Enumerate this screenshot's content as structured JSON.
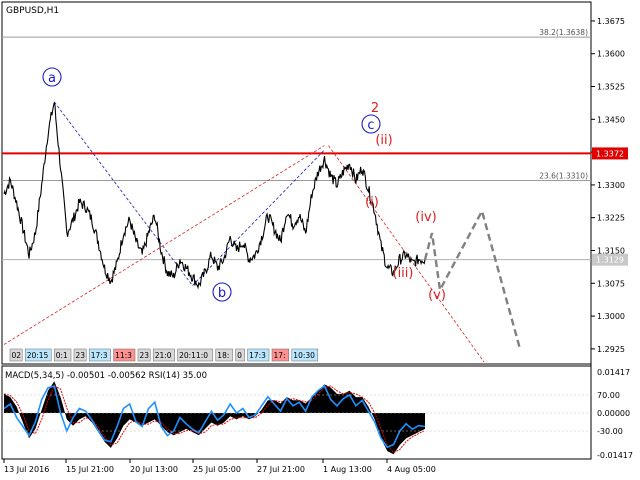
{
  "chart_title": "GBPUSD,H1",
  "indicator_title": "MACD(5,34,5) -0.00501 -0.00562 RSI(14) 35.00",
  "colors": {
    "price": "#000000",
    "resistance": "#e00000",
    "wave_blue": "#1a1acc",
    "wave_red": "#dd2020",
    "forecast": "#808080",
    "rsi": "#1e90ff",
    "current_price_bg": "#c8c8c8",
    "resistance_label_bg": "#e00000",
    "sessions_bg": "#d8d8d8"
  },
  "price_axis": {
    "ticks": [
      "1.3675",
      "1.3600",
      "1.3525",
      "1.3450",
      "1.3375",
      "1.3300",
      "1.3225",
      "1.3150",
      "1.3075",
      "1.3000",
      "1.2925"
    ],
    "resistance_label": "1.3372",
    "current_price_label": "1.3129"
  },
  "fibo_levels": [
    {
      "label": "38.2(1.3638)",
      "price": 1.3638
    },
    {
      "label": "23.6(1.3310)",
      "price": 1.331
    }
  ],
  "resistance_price": 1.3372,
  "current_price": 1.3129,
  "wave_labels": [
    {
      "text": "a",
      "style": "circle",
      "color": "blue"
    },
    {
      "text": "b",
      "style": "circle",
      "color": "blue"
    },
    {
      "text": "c",
      "style": "circle",
      "color": "blue"
    },
    {
      "text": "2",
      "style": "plain",
      "color": "red"
    },
    {
      "text": "(i)",
      "style": "plain",
      "color": "red"
    },
    {
      "text": "(ii)",
      "style": "plain",
      "color": "red"
    },
    {
      "text": "(iii)",
      "style": "plain",
      "color": "red"
    },
    {
      "text": "(iv)",
      "style": "plain",
      "color": "red"
    },
    {
      "text": "(v)",
      "style": "plain",
      "color": "red"
    }
  ],
  "sessions_strip": [
    "02",
    "20:15",
    "0:1",
    "23",
    "17:3",
    "11:3",
    "23",
    "21:0",
    "20:11:0",
    "18:",
    "0",
    "17:3",
    "17:",
    "10:30"
  ],
  "indicator_axis": {
    "ticks": [
      "0.01417",
      "70.00",
      "0.00000",
      "-30.00",
      "-0.01417"
    ]
  },
  "time_axis": [
    "13 Jul 2016",
    "15 Jul 21:00",
    "20 Jul 13:00",
    "25 Jul 05:00",
    "27 Jul 21:00",
    "1 Aug 13:00",
    "4 Aug 05:00"
  ],
  "chart_data": {
    "type": "line",
    "symbol": "GBPUSD",
    "timeframe": "H1",
    "ylim": [
      1.2895,
      1.37
    ],
    "x_labels": [
      "13 Jul 2016",
      "15 Jul 21:00",
      "20 Jul 13:00",
      "25 Jul 05:00",
      "27 Jul 21:00",
      "1 Aug 13:00",
      "4 Aug 05:00"
    ],
    "close_series": [
      1.328,
      1.331,
      1.326,
      1.32,
      1.314,
      1.319,
      1.33,
      1.342,
      1.349,
      1.334,
      1.319,
      1.322,
      1.326,
      1.325,
      1.322,
      1.317,
      1.311,
      1.308,
      1.312,
      1.319,
      1.322,
      1.317,
      1.314,
      1.319,
      1.323,
      1.315,
      1.31,
      1.309,
      1.313,
      1.311,
      1.309,
      1.307,
      1.31,
      1.314,
      1.311,
      1.313,
      1.318,
      1.315,
      1.317,
      1.313,
      1.314,
      1.318,
      1.323,
      1.32,
      1.317,
      1.324,
      1.321,
      1.323,
      1.319,
      1.328,
      1.333,
      1.336,
      1.332,
      1.33,
      1.333,
      1.335,
      1.331,
      1.334,
      1.329,
      1.324,
      1.316,
      1.311,
      1.31,
      1.313,
      1.314,
      1.312,
      1.313,
      1.3129
    ],
    "forecast_path": [
      1.3129,
      1.319,
      1.306,
      1.324,
      1.2925
    ],
    "macd_histogram": [
      0.006,
      0.005,
      0.002,
      -0.003,
      -0.008,
      -0.005,
      0.001,
      0.007,
      0.01,
      0.005,
      -0.002,
      -0.004,
      -0.002,
      -0.001,
      -0.003,
      -0.006,
      -0.009,
      -0.011,
      -0.008,
      -0.004,
      -0.002,
      -0.003,
      -0.004,
      -0.003,
      -0.002,
      -0.004,
      -0.006,
      -0.007,
      -0.006,
      -0.005,
      -0.006,
      -0.007,
      -0.005,
      -0.003,
      -0.004,
      -0.003,
      -0.001,
      -0.002,
      -0.001,
      -0.002,
      -0.001,
      0.001,
      0.004,
      0.004,
      0.003,
      0.005,
      0.004,
      0.004,
      0.003,
      0.005,
      0.007,
      0.009,
      0.008,
      0.006,
      0.006,
      0.007,
      0.005,
      0.005,
      0.002,
      -0.002,
      -0.008,
      -0.012,
      -0.013,
      -0.01,
      -0.008,
      -0.007,
      -0.006,
      -0.005
    ],
    "rsi": [
      55,
      60,
      45,
      35,
      25,
      40,
      65,
      78,
      80,
      50,
      30,
      45,
      55,
      52,
      42,
      30,
      20,
      18,
      35,
      55,
      60,
      40,
      35,
      55,
      62,
      35,
      25,
      30,
      45,
      38,
      32,
      28,
      40,
      52,
      42,
      48,
      60,
      50,
      55,
      45,
      48,
      58,
      68,
      60,
      52,
      66,
      58,
      62,
      52,
      68,
      75,
      80,
      65,
      58,
      66,
      70,
      58,
      64,
      52,
      40,
      22,
      12,
      15,
      30,
      38,
      32,
      36,
      35
    ],
    "macd_scale": [
      -0.01417,
      0.01417
    ],
    "rsi_levels": [
      70,
      30
    ]
  }
}
